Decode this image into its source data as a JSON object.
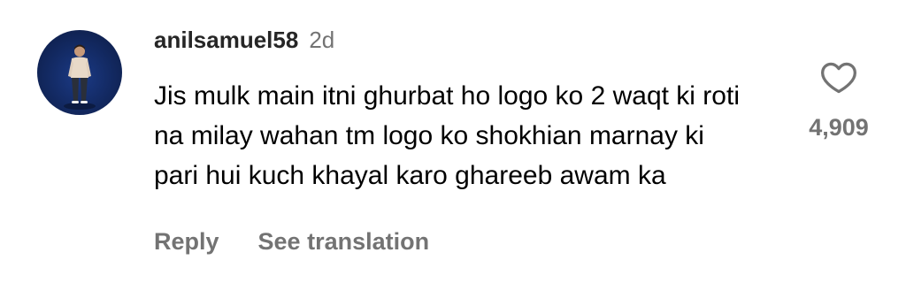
{
  "comment": {
    "username": "anilsamuel58",
    "timestamp": "2d",
    "text": "Jis mulk main itni ghurbat ho logo ko 2 waqt ki roti na milay wahan tm logo ko shokhian marnay ki pari hui kuch khayal karo ghareeb awam ka",
    "like_count": "4,909",
    "actions": {
      "reply_label": "Reply",
      "translate_label": "See translation"
    },
    "icons": {
      "like": "heart-icon",
      "avatar": "avatar"
    }
  },
  "colors": {
    "primary_text": "#000000",
    "username_text": "#262626",
    "secondary_text": "#737373",
    "avatar_background": "#12285f"
  }
}
